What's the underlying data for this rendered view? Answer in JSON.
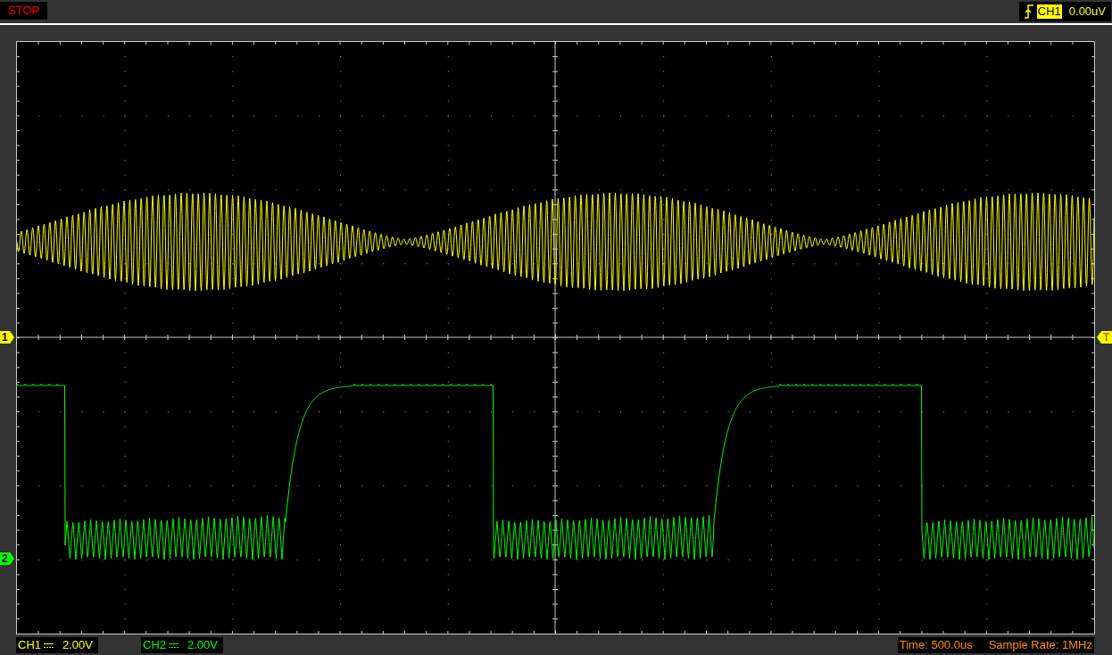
{
  "run_state": {
    "label": "STOP"
  },
  "trigger": {
    "source": "CH1",
    "level": "0.00uV"
  },
  "channel_markers": [
    {
      "label": "1",
      "color": "#ffff00"
    },
    {
      "label": "2",
      "color": "#00ff00"
    }
  ],
  "trigger_marker": {
    "label": "T"
  },
  "channels": [
    {
      "name": "CH1",
      "volts_per_div": "2.00V",
      "color": "#ffff00"
    },
    {
      "name": "CH2",
      "volts_per_div": "2.00V",
      "color": "#00ff00"
    }
  ],
  "timebase": "Time: 500.0us",
  "sample_rate": "Sample Rate: 1MHz"
}
